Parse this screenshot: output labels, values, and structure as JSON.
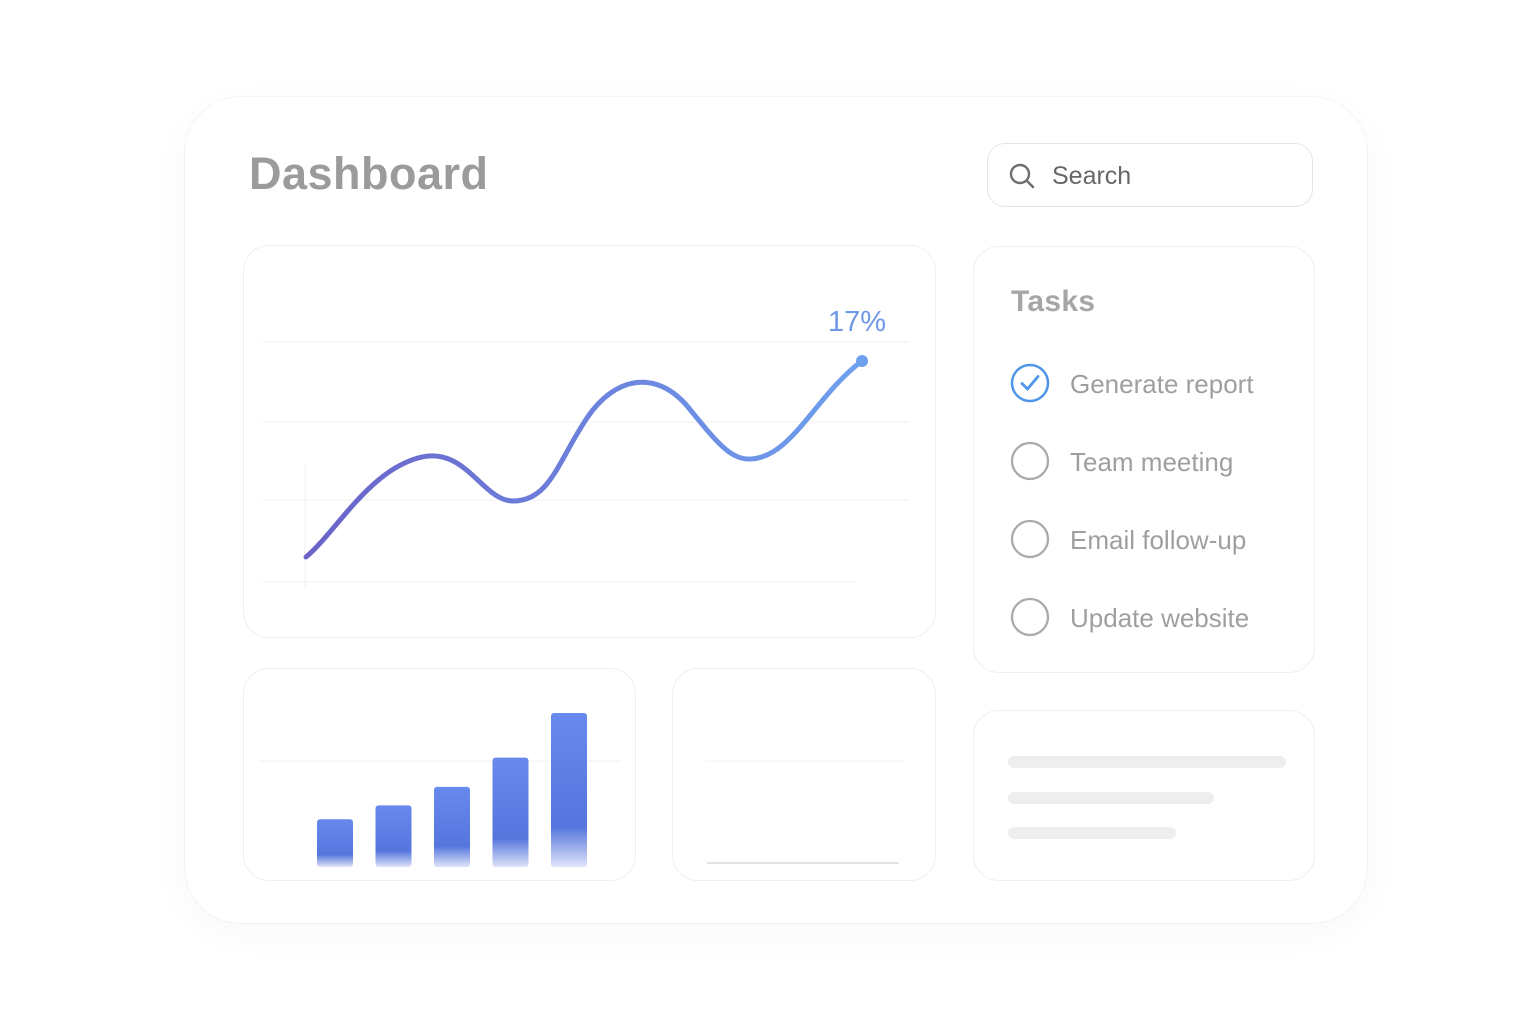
{
  "header": {
    "title": "Dashboard"
  },
  "search": {
    "placeholder": "Search",
    "icon": "search-icon"
  },
  "tasks": {
    "title": "Tasks",
    "items": [
      {
        "label": "Generate report",
        "checked": true
      },
      {
        "label": "Team meeting",
        "checked": false
      },
      {
        "label": "Email follow-up",
        "checked": false
      },
      {
        "label": "Update website",
        "checked": false
      }
    ]
  },
  "chart_data": [
    {
      "type": "line",
      "annotation": "17%",
      "trend": "upward wavy line ending at highlighted point",
      "colors": {
        "start": "#6b63c9",
        "end": "#6ea0ef"
      }
    },
    {
      "type": "bar",
      "relative_values": [
        0.31,
        0.4,
        0.52,
        0.71,
        1.0
      ],
      "color": "#5b7ee8"
    }
  ],
  "colors": {
    "accent": "#4f95e8",
    "muted": "#9f9f9f"
  }
}
